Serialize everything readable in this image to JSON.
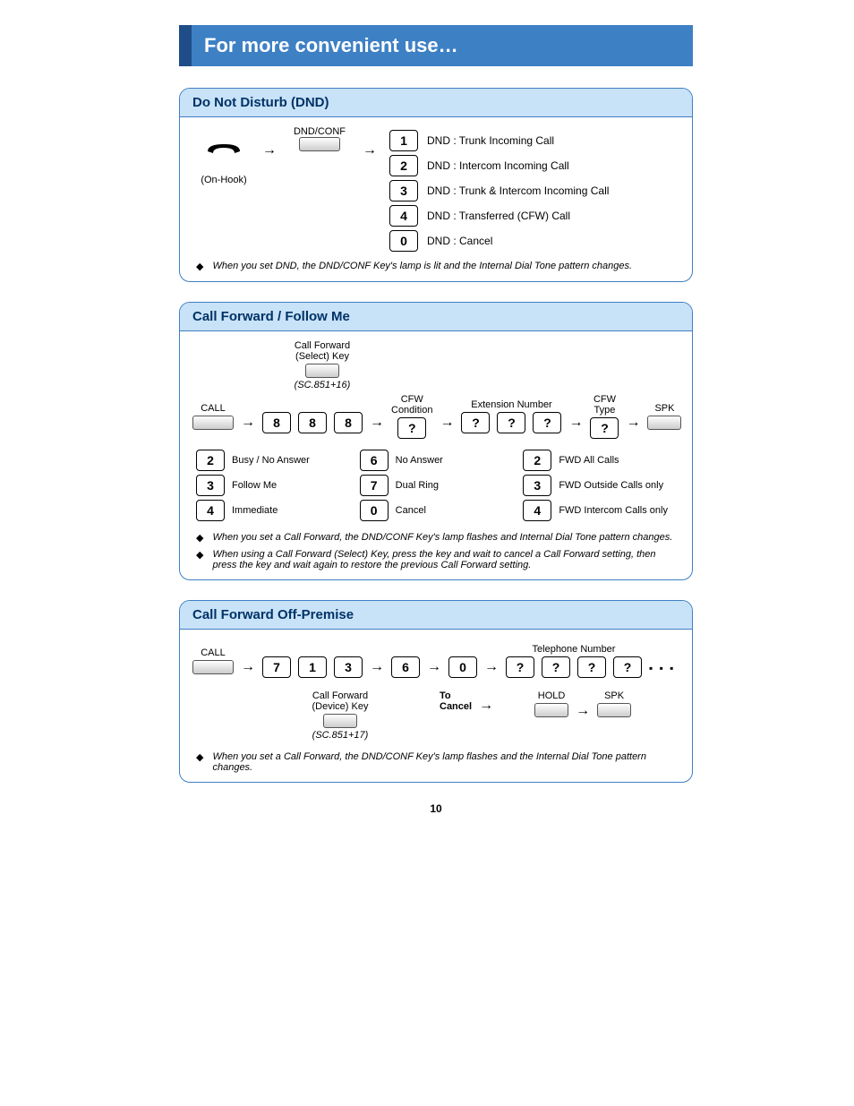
{
  "banner": "For more convenient use…",
  "page_number": "10",
  "dnd": {
    "title": "Do Not Disturb (DND)",
    "key_label": "DND/CONF",
    "hook_label": "(On-Hook)",
    "options": [
      {
        "key": "1",
        "text": "DND : Trunk Incoming Call"
      },
      {
        "key": "2",
        "text": "DND : Intercom Incoming Call"
      },
      {
        "key": "3",
        "text": "DND : Trunk & Intercom Incoming Call"
      },
      {
        "key": "4",
        "text": "DND : Transferred (CFW) Call"
      },
      {
        "key": "0",
        "text": "DND : Cancel"
      }
    ],
    "note": "When you set DND, the DND/CONF Key's lamp is lit and the Internal Dial Tone pattern changes."
  },
  "cfw": {
    "title": "Call Forward / Follow Me",
    "select_key_label_1": "Call Forward",
    "select_key_label_2": "(Select) Key",
    "select_code": "(SC.851+16)",
    "call_label": "CALL",
    "seq": [
      "8",
      "8",
      "8"
    ],
    "cond_label_1": "CFW",
    "cond_label_2": "Condition",
    "cond_key": "?",
    "ext_label": "Extension Number",
    "ext_keys": [
      "?",
      "?",
      "?"
    ],
    "type_label": "CFW Type",
    "type_key": "?",
    "spk_label": "SPK",
    "conditions": [
      {
        "key": "2",
        "text": "Busy / No Answer"
      },
      {
        "key": "3",
        "text": "Follow Me"
      },
      {
        "key": "4",
        "text": "Immediate"
      }
    ],
    "conditions2": [
      {
        "key": "6",
        "text": "No Answer"
      },
      {
        "key": "7",
        "text": "Dual Ring"
      },
      {
        "key": "0",
        "text": "Cancel"
      }
    ],
    "types": [
      {
        "key": "2",
        "text": "FWD All Calls"
      },
      {
        "key": "3",
        "text": "FWD Outside Calls only"
      },
      {
        "key": "4",
        "text": "FWD Intercom Calls only"
      }
    ],
    "note1": "When you set a Call Forward, the DND/CONF Key's lamp flashes and Internal Dial Tone pattern changes.",
    "note2": "When using a Call Forward (Select) Key, press the key and wait to cancel a Call Forward setting, then press the key and wait again to restore the previous Call Forward setting."
  },
  "cfop": {
    "title": "Call Forward Off-Premise",
    "call_label": "CALL",
    "seq": [
      "7",
      "1",
      "3"
    ],
    "six": "6",
    "zero": "0",
    "tel_label": "Telephone Number",
    "tel_keys": [
      "?",
      "?",
      "?",
      "?"
    ],
    "device_label_1": "Call Forward",
    "device_label_2": "(Device) Key",
    "device_code": "(SC.851+17)",
    "to_cancel_1": "To",
    "to_cancel_2": "Cancel",
    "hold_label": "HOLD",
    "spk_label": "SPK",
    "note": "When you set a Call Forward, the DND/CONF Key's lamp flashes and the Internal Dial Tone pattern changes."
  }
}
